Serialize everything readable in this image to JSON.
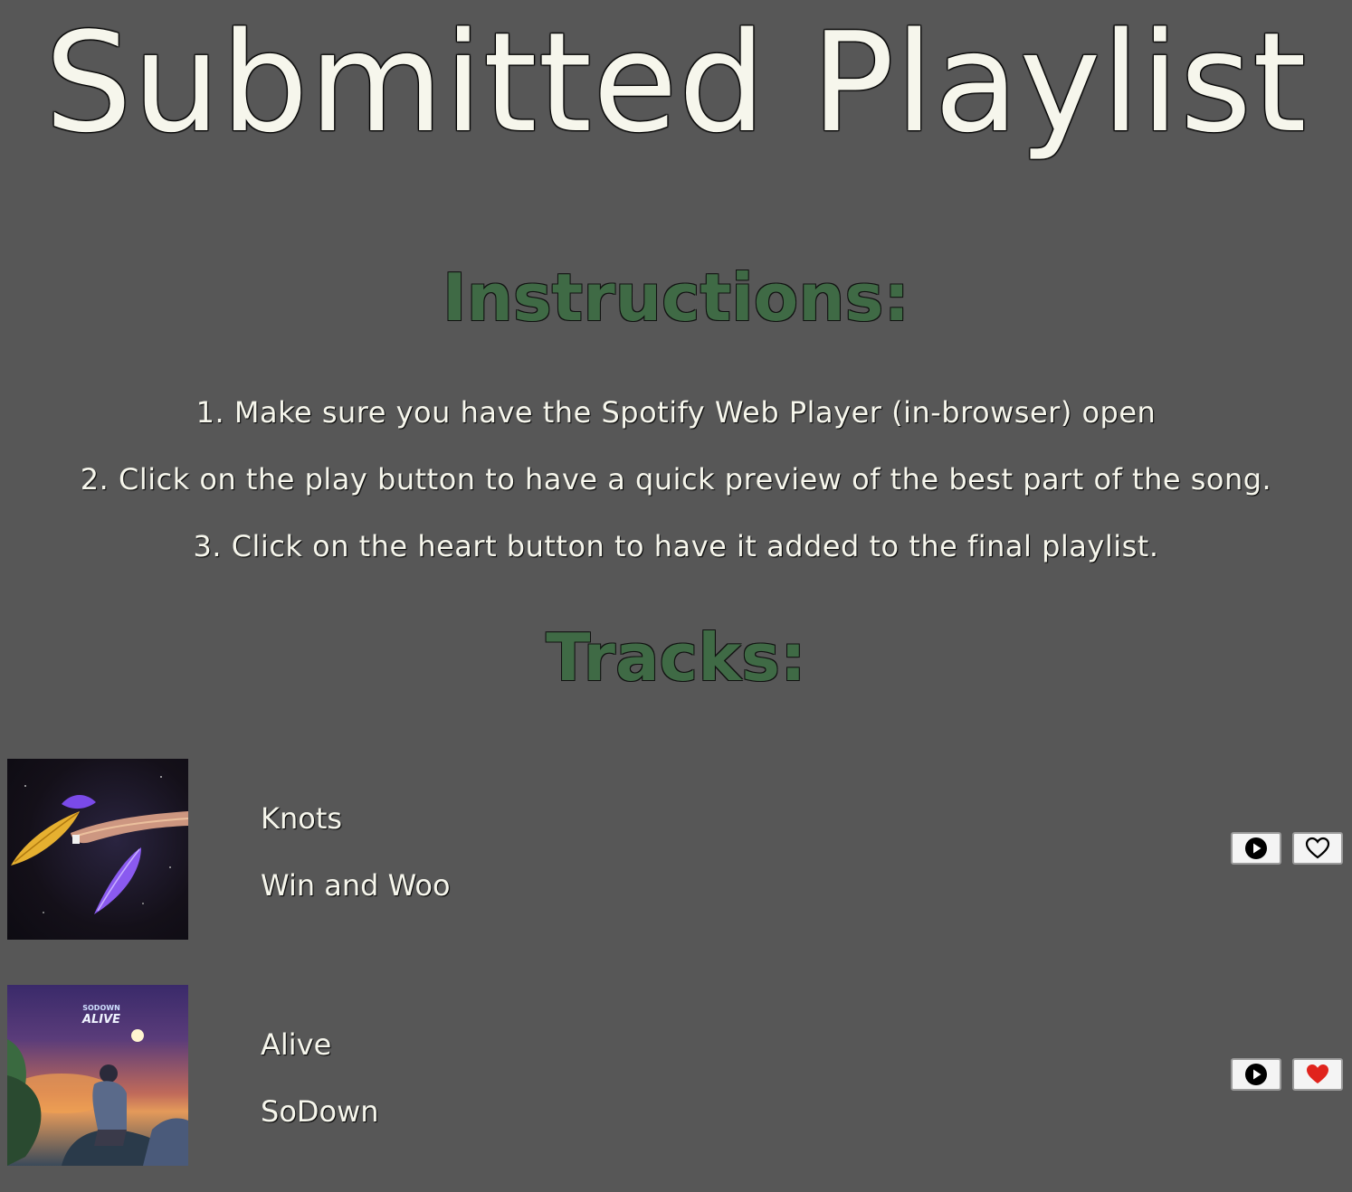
{
  "page": {
    "title": "Submitted Playlist",
    "instructions_heading": "Instructions:",
    "tracks_heading": "Tracks:"
  },
  "instructions": [
    "1. Make sure you have the Spotify Web Player (in-browser) open",
    "2. Click on the play button to have a quick preview of the best part of the song.",
    "3. Click on the heart button to have it added to the final playlist."
  ],
  "tracks": [
    {
      "name": "Knots",
      "artist": "Win and Woo",
      "cover_text_top": "",
      "cover_text_bottom": "",
      "liked": false,
      "play_icon": "play-circle-icon",
      "heart_icon": "heart-outline-icon"
    },
    {
      "name": "Alive",
      "artist": "SoDown",
      "cover_text_top": "SODOWN",
      "cover_text_bottom": "ALIVE",
      "liked": true,
      "play_icon": "play-circle-icon",
      "heart_icon": "heart-filled-icon"
    }
  ],
  "colors": {
    "background": "#575757",
    "title_text": "#f6f6ec",
    "heading_green": "#3f6a45",
    "heart_red": "#e0231c"
  }
}
